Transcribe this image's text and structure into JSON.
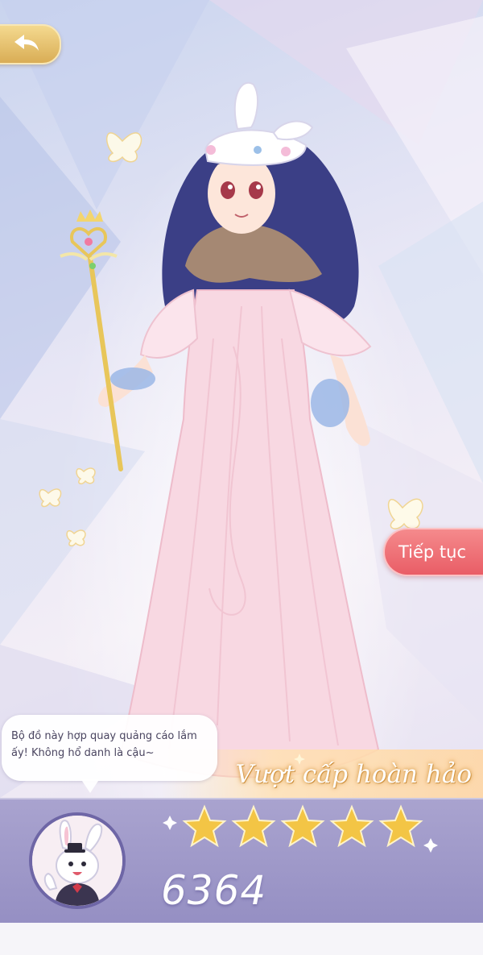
{
  "buttons": {
    "back_icon": "back-arrow-icon",
    "continue_label": "Tiếp tục"
  },
  "dialogue": {
    "line1": "Bộ đồ này hợp quay quảng cáo lắm",
    "line2": "ấy! Không hổ danh là cậu~"
  },
  "result": {
    "rank_title": "Vượt cấp hoàn hảo",
    "stars": 5,
    "max_stars": 5,
    "score": "6364"
  },
  "colors": {
    "continue_button": "#e95d66",
    "back_button": "#d9ad55",
    "panel": "#958fc3",
    "star": "#f3c545"
  }
}
